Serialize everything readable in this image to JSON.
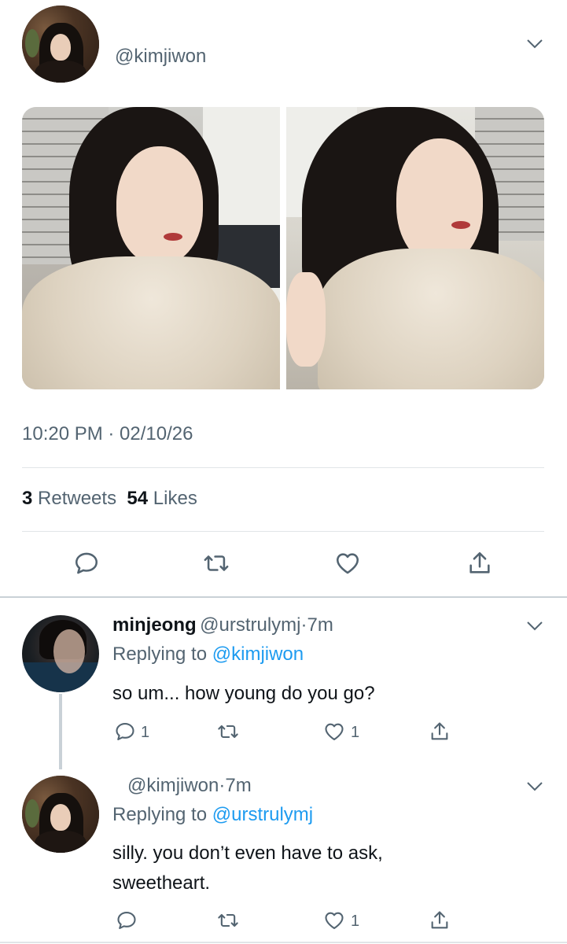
{
  "tweet": {
    "handle": "@kimjiwon",
    "timestamp": "10:20 PM · 02/10/26",
    "retweets_count": "3",
    "retweets_label": "Retweets",
    "likes_count": "54",
    "likes_label": "Likes"
  },
  "replies": [
    {
      "name": "minjeong",
      "handle": "@urstrulymj",
      "time": "7m",
      "replying_prefix": "Replying to",
      "replying_to": "@kimjiwon",
      "text": "so um... how young do you go?",
      "reply_count": "1",
      "like_count": "1"
    },
    {
      "name": "",
      "handle": "@kimjiwon",
      "time": "7m",
      "replying_prefix": "Replying to",
      "replying_to": "@urstrulymj",
      "text_line1": "silly. you don’t even have to ask,",
      "text_line2": "sweetheart.",
      "like_count": "1"
    }
  ],
  "icons": {
    "reply": "reply-icon",
    "retweet": "retweet-icon",
    "like": "heart-icon",
    "share": "share-icon",
    "more": "chevron-down-icon"
  },
  "colors": {
    "link": "#1d9bf0",
    "secondary_text": "#536471",
    "primary_text": "#0f1419",
    "divider": "#e1e5e8"
  }
}
